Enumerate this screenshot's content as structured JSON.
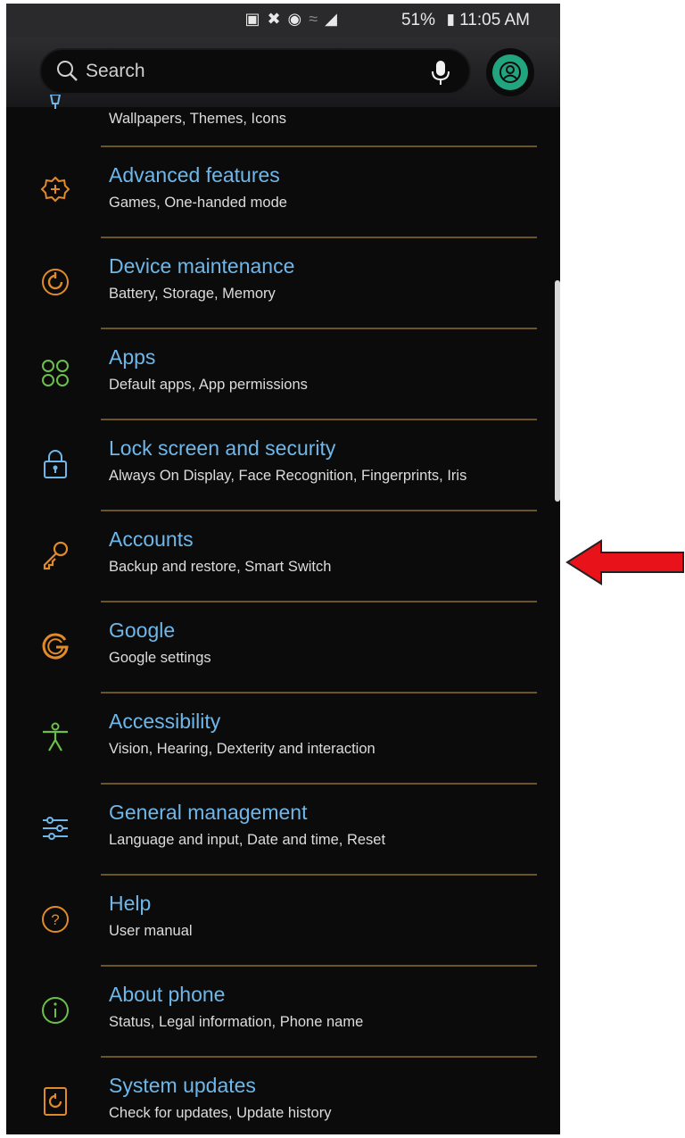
{
  "status_bar": {
    "battery": "51%",
    "time": "11:05 AM"
  },
  "search": {
    "placeholder": "Search"
  },
  "settings": [
    {
      "title": "",
      "subtitle": "Wallpapers, Themes, Icons",
      "icon": "brush-icon"
    },
    {
      "title": "Advanced features",
      "subtitle": "Games, One-handed mode",
      "icon": "gear-plus-icon"
    },
    {
      "title": "Device maintenance",
      "subtitle": "Battery, Storage, Memory",
      "icon": "refresh-icon"
    },
    {
      "title": "Apps",
      "subtitle": "Default apps, App permissions",
      "icon": "apps-grid-icon"
    },
    {
      "title": "Lock screen and security",
      "subtitle": "Always On Display, Face Recognition, Fingerprints, Iris",
      "icon": "lock-icon"
    },
    {
      "title": "Accounts",
      "subtitle": "Backup and restore, Smart Switch",
      "icon": "key-icon"
    },
    {
      "title": "Google",
      "subtitle": "Google settings",
      "icon": "google-icon"
    },
    {
      "title": "Accessibility",
      "subtitle": "Vision, Hearing, Dexterity and interaction",
      "icon": "accessibility-icon"
    },
    {
      "title": "General management",
      "subtitle": "Language and input, Date and time, Reset",
      "icon": "sliders-icon"
    },
    {
      "title": "Help",
      "subtitle": "User manual",
      "icon": "help-icon"
    },
    {
      "title": "About phone",
      "subtitle": "Status, Legal information, Phone name",
      "icon": "info-icon"
    },
    {
      "title": "System updates",
      "subtitle": "Check for updates, Update history",
      "icon": "system-update-icon"
    }
  ],
  "colors": {
    "background": "#0b0b0c",
    "title": "#6fb7e8",
    "subtitle": "#dcdcdc",
    "divider": "#6e5424",
    "icon_orange": "#e08a2a",
    "icon_green": "#6cc04a",
    "profile": "#21a57f",
    "arrow": "#e8121b"
  }
}
